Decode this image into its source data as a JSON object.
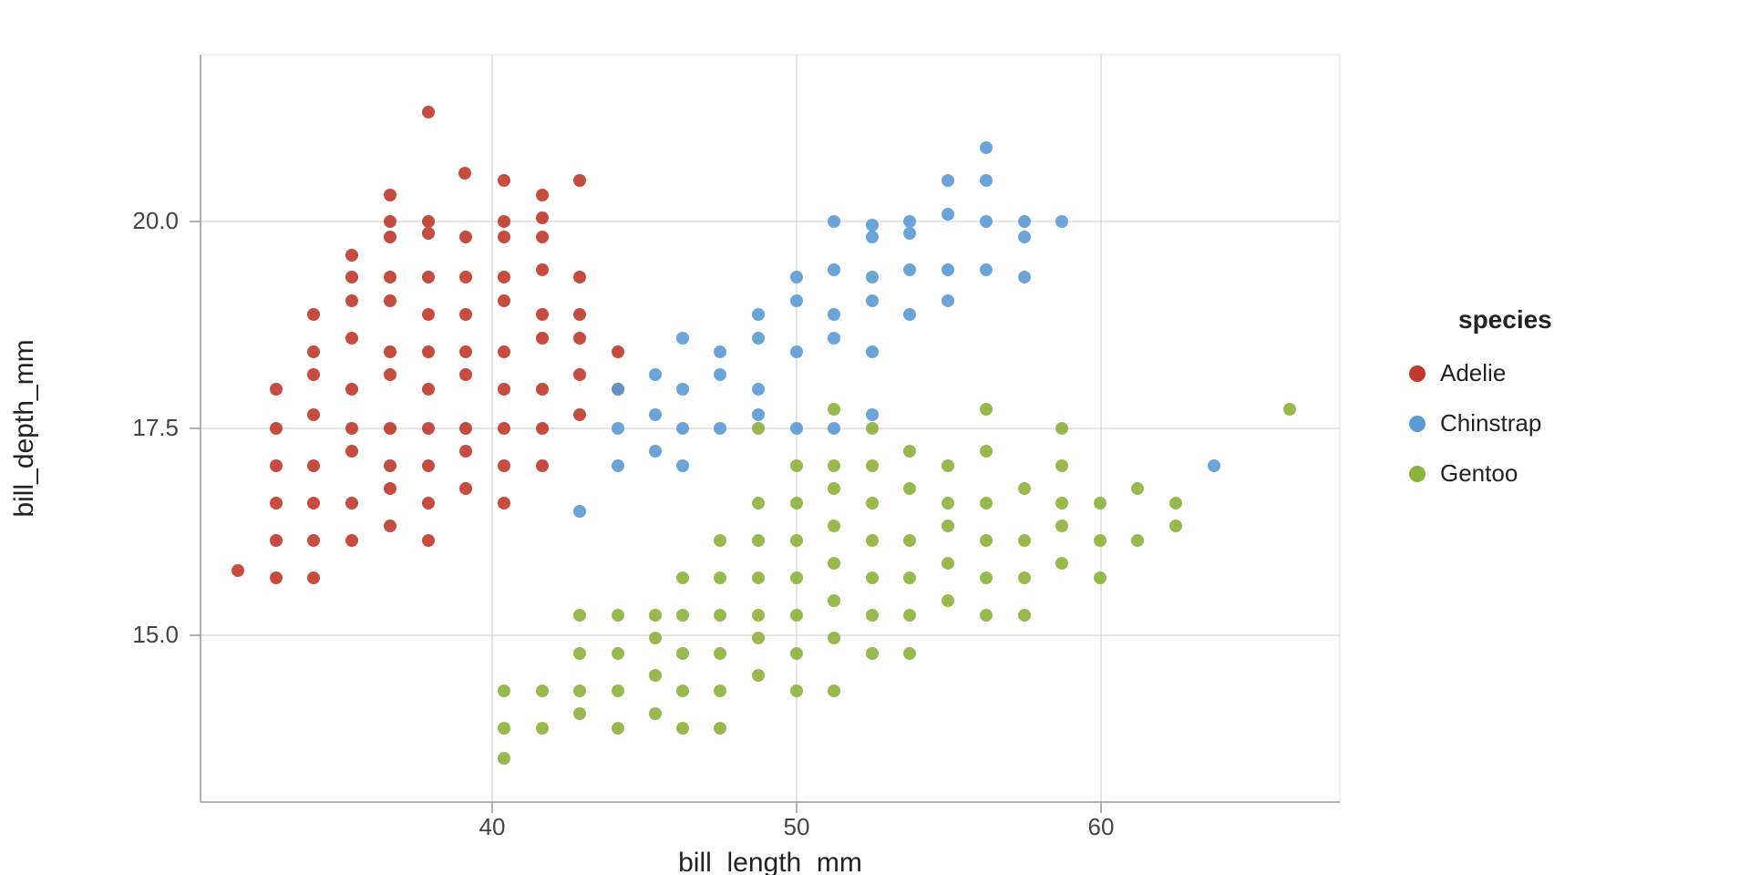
{
  "chart": {
    "title": "",
    "x_axis_label": "bill_length_mm",
    "y_axis_label": "bill_depth_mm",
    "legend_title": "species",
    "legend_items": [
      {
        "label": "Adelie",
        "color": "#c0392b"
      },
      {
        "label": "Chinstrap",
        "color": "#5b9bd5"
      },
      {
        "label": "Gentoo",
        "color": "#8db23a"
      }
    ],
    "x_ticks": [
      "40",
      "50",
      "60"
    ],
    "y_ticks": [
      "15.0",
      "17.5",
      "20.0"
    ],
    "colors": {
      "adelie": "#c0392b",
      "chinstrap": "#5b9bd5",
      "gentoo": "#8db23a",
      "grid": "#cccccc",
      "axis": "#999999",
      "background": "#ffffff",
      "plot_bg": "#ffffff"
    }
  }
}
